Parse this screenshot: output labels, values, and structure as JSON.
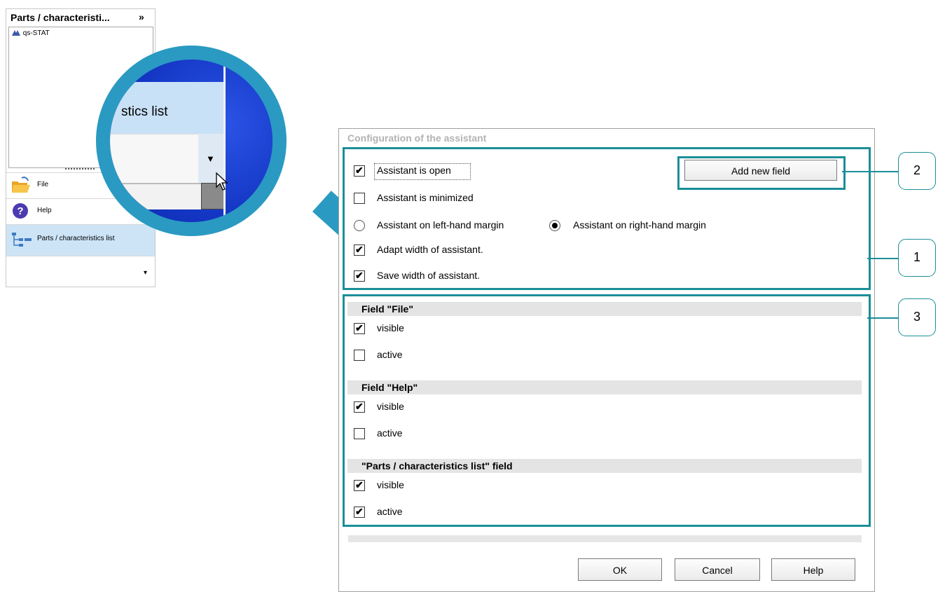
{
  "panel": {
    "title": "Parts / characteristi...",
    "expand_glyph": "»",
    "tree_root": "qs-STAT",
    "nav_items": [
      {
        "label": "File",
        "icon": "folder-open-icon"
      },
      {
        "label": "Help",
        "icon": "help-icon"
      },
      {
        "label": "Parts / characteristics list",
        "icon": "tree-list-icon"
      }
    ],
    "more_glyph": "▾"
  },
  "magnifier": {
    "item_text": "stics list",
    "arrow_glyph": "▼"
  },
  "dialog": {
    "title": "Configuration of the assistant",
    "options": {
      "assistant_open": {
        "label": "Assistant is open",
        "checked": true
      },
      "assistant_minimized": {
        "label": "Assistant is minimized",
        "checked": false
      },
      "left_margin": {
        "label": "Assistant on left-hand margin",
        "selected": false
      },
      "right_margin": {
        "label": "Assistant on right-hand margin",
        "selected": true
      },
      "adapt_width": {
        "label": "Adapt width of assistant.",
        "checked": true
      },
      "save_width": {
        "label": "Save width of assistant.",
        "checked": true
      }
    },
    "add_field_label": "Add new field",
    "fields": [
      {
        "title": "Field \"File\"",
        "visible": {
          "label": "visible",
          "checked": true
        },
        "active": {
          "label": "active",
          "checked": false
        }
      },
      {
        "title": "Field \"Help\"",
        "visible": {
          "label": "visible",
          "checked": true
        },
        "active": {
          "label": "active",
          "checked": false
        }
      },
      {
        "title": "\"Parts / characteristics list\" field",
        "visible": {
          "label": "visible",
          "checked": true
        },
        "active": {
          "label": "active",
          "checked": true
        }
      }
    ],
    "buttons": {
      "ok": "OK",
      "cancel": "Cancel",
      "help": "Help"
    }
  },
  "callouts": [
    "2",
    "1",
    "3"
  ],
  "colors": {
    "frame": "#1b8e98",
    "magnifier": "#2a9ac2",
    "selection": "#cde4f7"
  }
}
